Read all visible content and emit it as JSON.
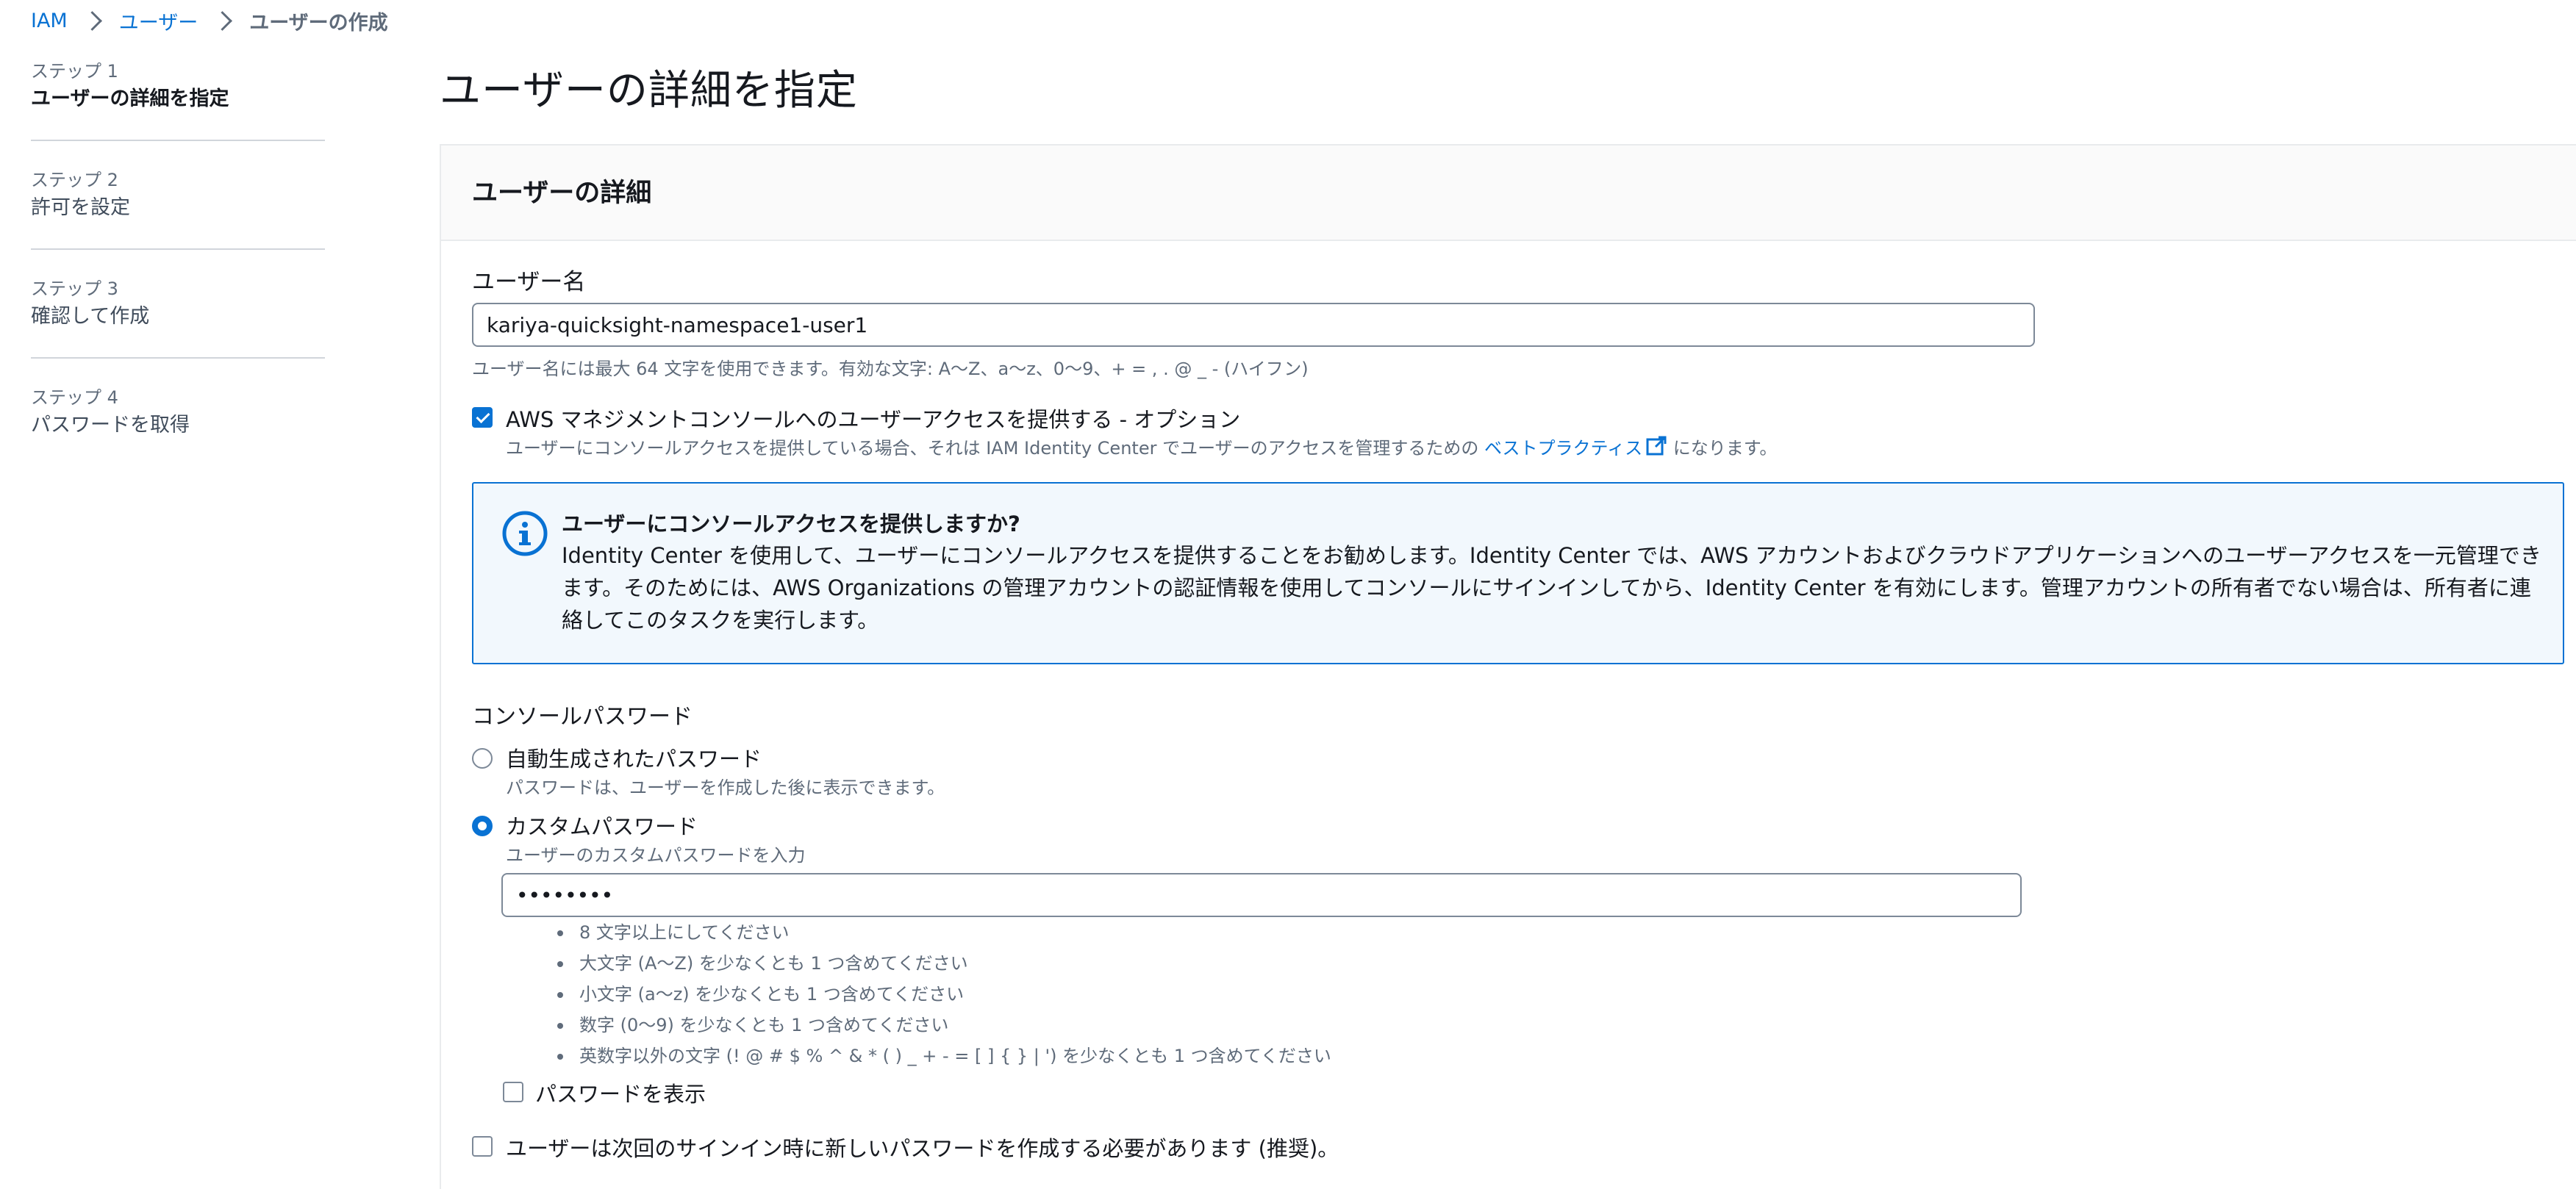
{
  "breadcrumb": {
    "iam": "IAM",
    "users": "ユーザー",
    "current": "ユーザーの作成"
  },
  "steps": [
    {
      "number": "ステップ 1",
      "title": "ユーザーの詳細を指定",
      "active": true
    },
    {
      "number": "ステップ 2",
      "title": "許可を設定",
      "active": false
    },
    {
      "number": "ステップ 3",
      "title": "確認して作成",
      "active": false
    },
    {
      "number": "ステップ 4",
      "title": "パスワードを取得",
      "active": false
    }
  ],
  "page": {
    "title": "ユーザーの詳細を指定"
  },
  "panel": {
    "title": "ユーザーの詳細"
  },
  "username": {
    "label": "ユーザー名",
    "value": "kariya-quicksight-namespace1-user1",
    "hint": "ユーザー名には最大 64 文字を使用できます。有効な文字: A～Z、a～z、0～9、+ = , . @ _ - (ハイフン)"
  },
  "console_access": {
    "checked": true,
    "label": "AWS マネジメントコンソールへのユーザーアクセスを提供する - オプション",
    "desc_before": "ユーザーにコンソールアクセスを提供している場合、それは IAM Identity Center でユーザーのアクセスを管理するための",
    "desc_link": "ベストプラクティス",
    "desc_after": "になります。"
  },
  "info": {
    "title": "ユーザーにコンソールアクセスを提供しますか?",
    "body": "Identity Center を使用して、ユーザーにコンソールアクセスを提供することをお勧めします。Identity Center では、AWS アカウントおよびクラウドアプリケーションへのユーザーアクセスを一元管理できます。そのためには、AWS Organizations の管理アカウントの認証情報を使用してコンソールにサインインしてから、Identity Center を有効にします。管理アカウントの所有者でない場合は、所有者に連絡してこのタスクを実行します。"
  },
  "password": {
    "section_label": "コンソールパスワード",
    "auto_label": "自動生成されたパスワード",
    "auto_desc": "パスワードは、ユーザーを作成した後に表示できます。",
    "custom_label": "カスタムパスワード",
    "custom_desc": "ユーザーのカスタムパスワードを入力",
    "value": "••••••••",
    "rules": [
      "8 文字以上にしてください",
      "大文字 (A～Z) を少なくとも 1 つ含めてください",
      "小文字 (a～z) を少なくとも 1 つ含めてください",
      "数字 (0～9) を少なくとも 1 つ含めてください",
      "英数字以外の文字 (! @ # $ % ^ & * ( ) _ + - = [ ] { } | ') を少なくとも 1 つ含めてください"
    ],
    "show_label": "パスワードを表示",
    "reset_label": "ユーザーは次回のサインイン時に新しいパスワードを作成する必要があります (推奨)。"
  },
  "colors": {
    "link": "#0972d3",
    "info_bg": "#f2f8fd",
    "muted": "#5f6b7a"
  }
}
